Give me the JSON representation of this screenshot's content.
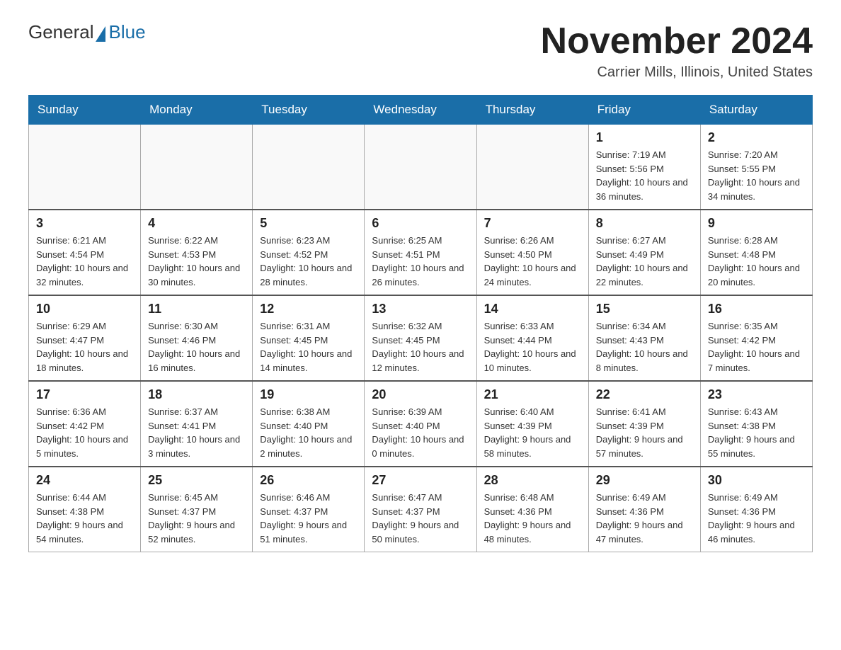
{
  "header": {
    "logo_general": "General",
    "logo_blue": "Blue",
    "month_title": "November 2024",
    "location": "Carrier Mills, Illinois, United States"
  },
  "weekdays": [
    "Sunday",
    "Monday",
    "Tuesday",
    "Wednesday",
    "Thursday",
    "Friday",
    "Saturday"
  ],
  "weeks": [
    [
      {
        "day": "",
        "info": ""
      },
      {
        "day": "",
        "info": ""
      },
      {
        "day": "",
        "info": ""
      },
      {
        "day": "",
        "info": ""
      },
      {
        "day": "",
        "info": ""
      },
      {
        "day": "1",
        "info": "Sunrise: 7:19 AM\nSunset: 5:56 PM\nDaylight: 10 hours and 36 minutes."
      },
      {
        "day": "2",
        "info": "Sunrise: 7:20 AM\nSunset: 5:55 PM\nDaylight: 10 hours and 34 minutes."
      }
    ],
    [
      {
        "day": "3",
        "info": "Sunrise: 6:21 AM\nSunset: 4:54 PM\nDaylight: 10 hours and 32 minutes."
      },
      {
        "day": "4",
        "info": "Sunrise: 6:22 AM\nSunset: 4:53 PM\nDaylight: 10 hours and 30 minutes."
      },
      {
        "day": "5",
        "info": "Sunrise: 6:23 AM\nSunset: 4:52 PM\nDaylight: 10 hours and 28 minutes."
      },
      {
        "day": "6",
        "info": "Sunrise: 6:25 AM\nSunset: 4:51 PM\nDaylight: 10 hours and 26 minutes."
      },
      {
        "day": "7",
        "info": "Sunrise: 6:26 AM\nSunset: 4:50 PM\nDaylight: 10 hours and 24 minutes."
      },
      {
        "day": "8",
        "info": "Sunrise: 6:27 AM\nSunset: 4:49 PM\nDaylight: 10 hours and 22 minutes."
      },
      {
        "day": "9",
        "info": "Sunrise: 6:28 AM\nSunset: 4:48 PM\nDaylight: 10 hours and 20 minutes."
      }
    ],
    [
      {
        "day": "10",
        "info": "Sunrise: 6:29 AM\nSunset: 4:47 PM\nDaylight: 10 hours and 18 minutes."
      },
      {
        "day": "11",
        "info": "Sunrise: 6:30 AM\nSunset: 4:46 PM\nDaylight: 10 hours and 16 minutes."
      },
      {
        "day": "12",
        "info": "Sunrise: 6:31 AM\nSunset: 4:45 PM\nDaylight: 10 hours and 14 minutes."
      },
      {
        "day": "13",
        "info": "Sunrise: 6:32 AM\nSunset: 4:45 PM\nDaylight: 10 hours and 12 minutes."
      },
      {
        "day": "14",
        "info": "Sunrise: 6:33 AM\nSunset: 4:44 PM\nDaylight: 10 hours and 10 minutes."
      },
      {
        "day": "15",
        "info": "Sunrise: 6:34 AM\nSunset: 4:43 PM\nDaylight: 10 hours and 8 minutes."
      },
      {
        "day": "16",
        "info": "Sunrise: 6:35 AM\nSunset: 4:42 PM\nDaylight: 10 hours and 7 minutes."
      }
    ],
    [
      {
        "day": "17",
        "info": "Sunrise: 6:36 AM\nSunset: 4:42 PM\nDaylight: 10 hours and 5 minutes."
      },
      {
        "day": "18",
        "info": "Sunrise: 6:37 AM\nSunset: 4:41 PM\nDaylight: 10 hours and 3 minutes."
      },
      {
        "day": "19",
        "info": "Sunrise: 6:38 AM\nSunset: 4:40 PM\nDaylight: 10 hours and 2 minutes."
      },
      {
        "day": "20",
        "info": "Sunrise: 6:39 AM\nSunset: 4:40 PM\nDaylight: 10 hours and 0 minutes."
      },
      {
        "day": "21",
        "info": "Sunrise: 6:40 AM\nSunset: 4:39 PM\nDaylight: 9 hours and 58 minutes."
      },
      {
        "day": "22",
        "info": "Sunrise: 6:41 AM\nSunset: 4:39 PM\nDaylight: 9 hours and 57 minutes."
      },
      {
        "day": "23",
        "info": "Sunrise: 6:43 AM\nSunset: 4:38 PM\nDaylight: 9 hours and 55 minutes."
      }
    ],
    [
      {
        "day": "24",
        "info": "Sunrise: 6:44 AM\nSunset: 4:38 PM\nDaylight: 9 hours and 54 minutes."
      },
      {
        "day": "25",
        "info": "Sunrise: 6:45 AM\nSunset: 4:37 PM\nDaylight: 9 hours and 52 minutes."
      },
      {
        "day": "26",
        "info": "Sunrise: 6:46 AM\nSunset: 4:37 PM\nDaylight: 9 hours and 51 minutes."
      },
      {
        "day": "27",
        "info": "Sunrise: 6:47 AM\nSunset: 4:37 PM\nDaylight: 9 hours and 50 minutes."
      },
      {
        "day": "28",
        "info": "Sunrise: 6:48 AM\nSunset: 4:36 PM\nDaylight: 9 hours and 48 minutes."
      },
      {
        "day": "29",
        "info": "Sunrise: 6:49 AM\nSunset: 4:36 PM\nDaylight: 9 hours and 47 minutes."
      },
      {
        "day": "30",
        "info": "Sunrise: 6:49 AM\nSunset: 4:36 PM\nDaylight: 9 hours and 46 minutes."
      }
    ]
  ]
}
